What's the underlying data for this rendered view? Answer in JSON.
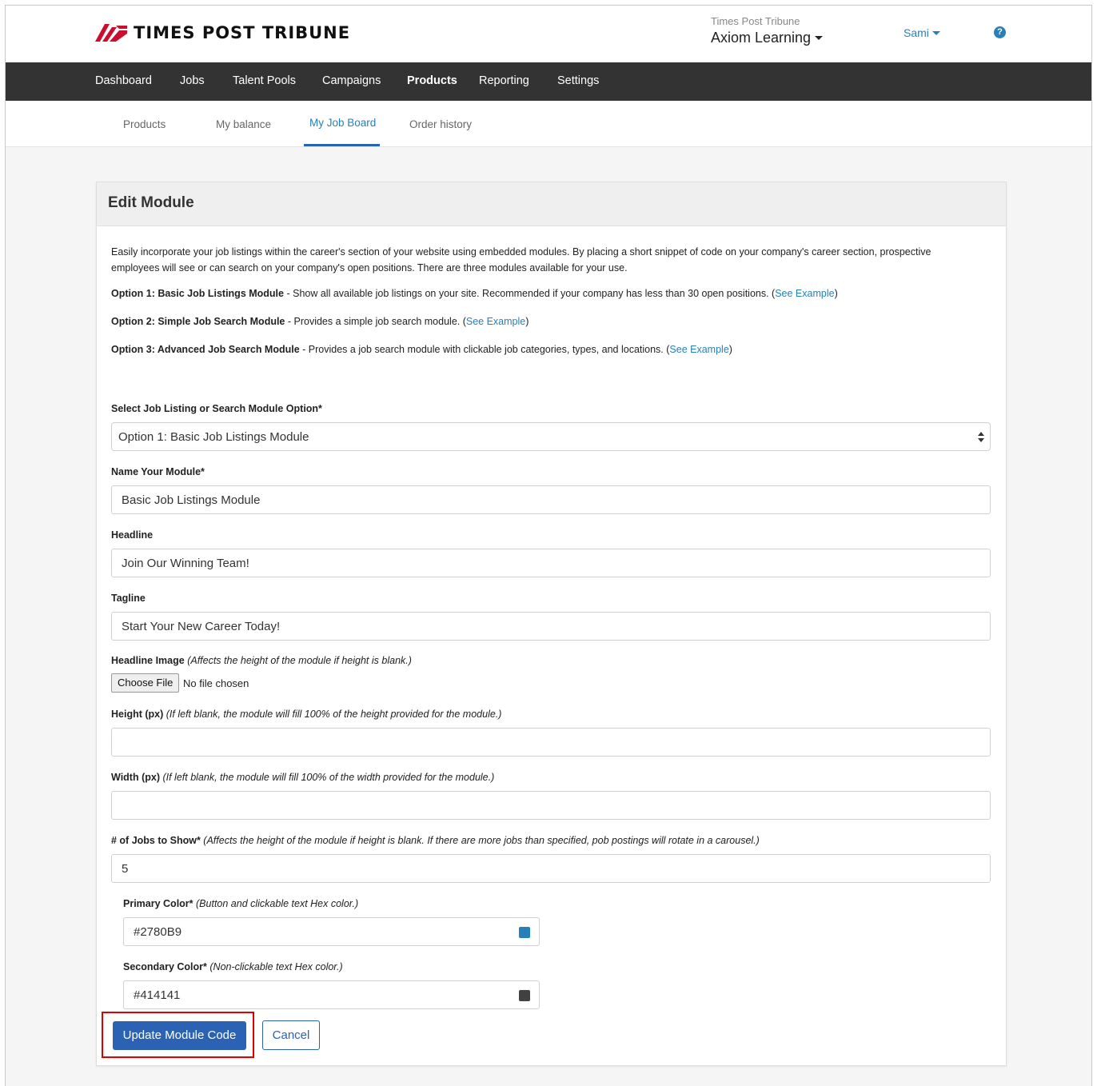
{
  "header": {
    "brand": "TIMES POST TRIBUNE",
    "org_small": "Times Post Tribune",
    "org_name": "Axiom Learning",
    "user": "Sami",
    "help_icon": "question-circle-icon"
  },
  "main_nav": [
    "Dashboard",
    "Jobs",
    "Talent Pools",
    "Campaigns",
    "Products",
    "Reporting",
    "Settings"
  ],
  "main_nav_active": "Products",
  "sub_nav": [
    "Products",
    "My balance",
    "My Job Board",
    "Order history"
  ],
  "sub_nav_active": "My Job Board",
  "card": {
    "title": "Edit Module",
    "intro": "Easily incorporate your job listings within the career's section of your website using embedded modules. By placing a short snippet of code on your company's career section, prospective employees will see or can search on your company's open positions. There are three modules available for your use.",
    "options": [
      {
        "title": "Option 1: Basic Job Listings Module",
        "desc": " - Show all available job listings on your site. Recommended if your company has less than 30 open positions. (",
        "link": "See Example",
        "close": ")"
      },
      {
        "title": "Option 2: Simple Job Search Module",
        "desc": " - Provides a simple job search module. (",
        "link": "See Example",
        "close": ")"
      },
      {
        "title": "Option 3: Advanced Job Search Module",
        "desc": " - Provides a job search module with clickable job categories, types, and locations. (",
        "link": "See Example",
        "close": ")"
      }
    ]
  },
  "form": {
    "module_option": {
      "label": "Select Job Listing or Search Module Option*",
      "value": "Option 1: Basic Job Listings Module"
    },
    "module_name": {
      "label": "Name Your Module*",
      "value": "Basic Job Listings Module"
    },
    "headline": {
      "label": "Headline",
      "value": "Join Our Winning Team!"
    },
    "tagline": {
      "label": "Tagline",
      "value": "Start Your New Career Today!"
    },
    "headline_image": {
      "label": "Headline Image",
      "note": "(Affects the height of the module if height is blank.)",
      "button": "Choose File",
      "status": "No file chosen"
    },
    "height": {
      "label": "Height (px)",
      "note": "(If left blank, the module will fill 100% of the height provided for the module.)",
      "value": ""
    },
    "width": {
      "label": "Width (px)",
      "note": "(If left blank, the module will fill 100% of the width provided for the module.)",
      "value": ""
    },
    "jobs_to_show": {
      "label": "# of Jobs to Show*",
      "note": "(Affects the height of the module if height is blank. If there are more jobs than specified, pob postings will rotate in a carousel.)",
      "value": "5"
    },
    "primary_color": {
      "label": "Primary Color*",
      "note": "(Button and clickable text Hex color.)",
      "value": "#2780B9",
      "swatch": "#2780B9"
    },
    "secondary_color": {
      "label": "Secondary Color*",
      "note": "(Non-clickable text Hex color.)",
      "value": "#414141",
      "swatch": "#414141"
    }
  },
  "actions": {
    "update": "Update Module Code",
    "cancel": "Cancel"
  },
  "colors": {
    "accent": "#2780B9",
    "button": "#2B62B3",
    "nav_bg": "#333333",
    "highlight": "#E00000"
  }
}
